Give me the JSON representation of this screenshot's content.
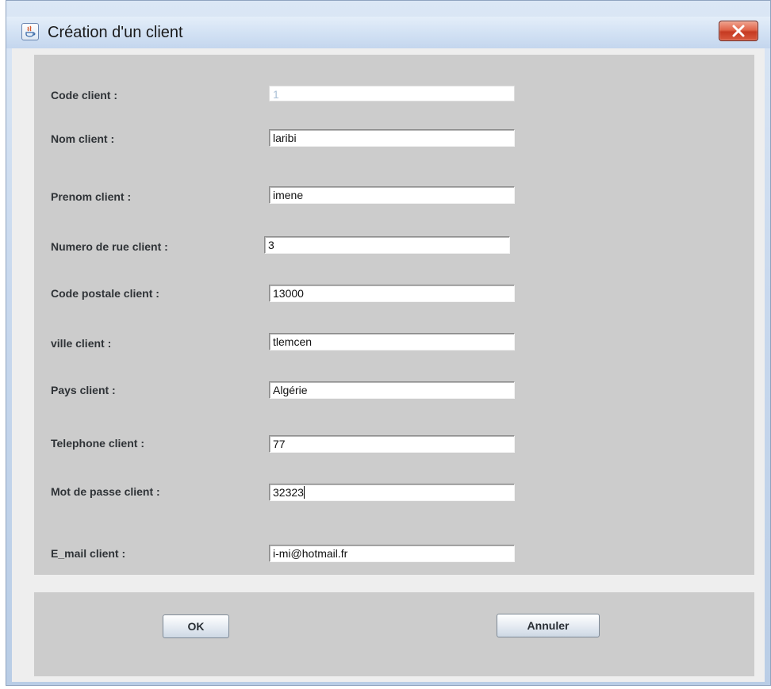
{
  "window": {
    "title": "Création d'un client",
    "icon": "java-icon",
    "close_icon": "close-icon"
  },
  "form": {
    "code": {
      "label": "Code client :",
      "value": "1",
      "enabled": false
    },
    "nom": {
      "label": "Nom client :",
      "value": "laribi"
    },
    "prenom": {
      "label": "Prenom client :",
      "value": "imene"
    },
    "rue": {
      "label": "Numero de rue client :",
      "value": "3"
    },
    "cp": {
      "label": "Code postale client :",
      "value": "13000"
    },
    "ville": {
      "label": "ville client :",
      "value": "tlemcen"
    },
    "pays": {
      "label": "Pays client :",
      "value": "Algérie"
    },
    "tel": {
      "label": "Telephone client :",
      "value": "77"
    },
    "mdp": {
      "label": "Mot de passe client :",
      "value": "32323",
      "focused": true
    },
    "email": {
      "label": "E_mail client :",
      "value": "i-mi@hotmail.fr"
    }
  },
  "buttons": {
    "ok": "OK",
    "annuler": "Annuler"
  },
  "colors": {
    "panel": "#cccccc",
    "close_button": "#d9593e",
    "disabled_text": "#a9bfd6"
  }
}
